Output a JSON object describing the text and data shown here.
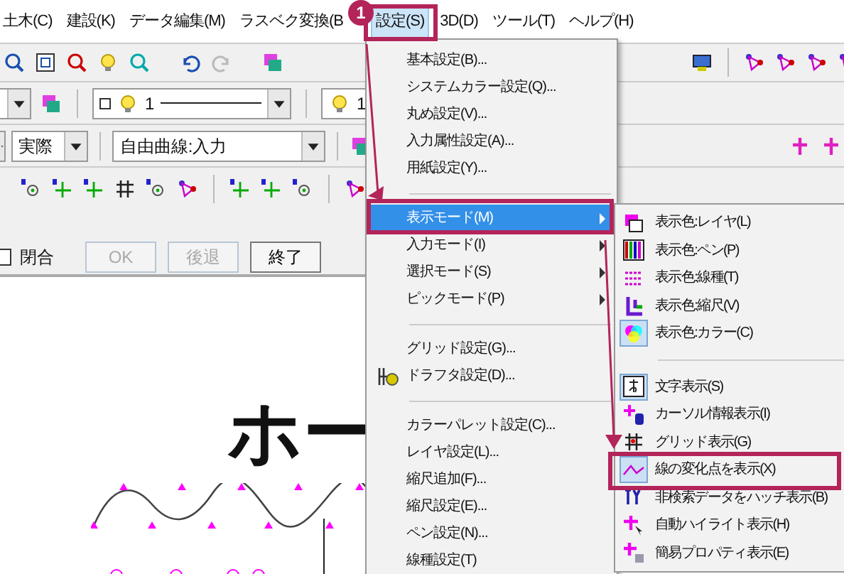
{
  "menubar": [
    {
      "label": "土木(C)",
      "selected": false
    },
    {
      "label": "建設(K)",
      "selected": false
    },
    {
      "label": "データ編集(M)",
      "selected": false
    },
    {
      "label": "ラスベク変換(B",
      "selected": false
    },
    {
      "label": "設定(S)",
      "selected": true
    },
    {
      "label": "3D(D)",
      "selected": false
    },
    {
      "label": "ツール(T)",
      "selected": false
    },
    {
      "label": "ヘルプ(H)",
      "selected": false
    }
  ],
  "toolbar": {
    "layer_combo": "1",
    "pen_combo": "1",
    "scale_combo": "実際",
    "command_combo": "自由曲線:入力"
  },
  "options": {
    "closed_label": "閉合",
    "closed_checked": false
  },
  "buttons": [
    {
      "label": "OK",
      "disabled": true
    },
    {
      "label": "後退",
      "disabled": true
    },
    {
      "label": "終了",
      "disabled": false
    }
  ],
  "canvas": {
    "text": "ホー"
  },
  "settings_menu": [
    {
      "kind": "item",
      "label": "基本設定(B)...",
      "selected": false,
      "submenu": false,
      "has_icon": false
    },
    {
      "kind": "item",
      "label": "システムカラー設定(Q)...",
      "selected": false,
      "submenu": false,
      "has_icon": false
    },
    {
      "kind": "item",
      "label": "丸め設定(V)...",
      "selected": false,
      "submenu": false,
      "has_icon": false
    },
    {
      "kind": "item",
      "label": "入力属性設定(A)...",
      "selected": false,
      "submenu": false,
      "has_icon": false
    },
    {
      "kind": "item",
      "label": "用紙設定(Y)...",
      "selected": false,
      "submenu": false,
      "has_icon": false
    },
    {
      "kind": "separator"
    },
    {
      "kind": "item",
      "label": "表示モード(M)",
      "selected": true,
      "submenu": true,
      "has_icon": false
    },
    {
      "kind": "item",
      "label": "入力モード(I)",
      "selected": false,
      "submenu": true,
      "has_icon": false
    },
    {
      "kind": "item",
      "label": "選択モード(S)",
      "selected": false,
      "submenu": true,
      "has_icon": false
    },
    {
      "kind": "item",
      "label": "ピックモード(P)",
      "selected": false,
      "submenu": true,
      "has_icon": false
    },
    {
      "kind": "separator"
    },
    {
      "kind": "item",
      "label": "グリッド設定(G)...",
      "selected": false,
      "submenu": false,
      "has_icon": false
    },
    {
      "kind": "item",
      "label": "ドラフタ設定(D)...",
      "selected": false,
      "submenu": false,
      "has_icon": true
    },
    {
      "kind": "separator"
    },
    {
      "kind": "item",
      "label": "カラーパレット設定(C)...",
      "selected": false,
      "submenu": false,
      "has_icon": false
    },
    {
      "kind": "item",
      "label": "レイヤ設定(L)...",
      "selected": false,
      "submenu": false,
      "has_icon": false
    },
    {
      "kind": "item",
      "label": "縮尺追加(F)...",
      "selected": false,
      "submenu": false,
      "has_icon": false
    },
    {
      "kind": "item",
      "label": "縮尺設定(E)...",
      "selected": false,
      "submenu": false,
      "has_icon": false
    },
    {
      "kind": "item",
      "label": "ペン設定(N)...",
      "selected": false,
      "submenu": false,
      "has_icon": false
    },
    {
      "kind": "item",
      "label": "線種設定(T)",
      "selected": false,
      "submenu": false,
      "has_icon": false
    }
  ],
  "display_submenu": [
    {
      "kind": "item",
      "label": "表示色:レイヤ(L)",
      "checked": false
    },
    {
      "kind": "item",
      "label": "表示色:ペン(P)",
      "checked": false
    },
    {
      "kind": "item",
      "label": "表示色:線種(T)",
      "checked": false
    },
    {
      "kind": "item",
      "label": "表示色:縮尺(V)",
      "checked": false
    },
    {
      "kind": "item",
      "label": "表示色:カラー(C)",
      "checked": true
    },
    {
      "kind": "separator"
    },
    {
      "kind": "item",
      "label": "文字表示(S)",
      "checked": true
    },
    {
      "kind": "item",
      "label": "カーソル情報表示(I)",
      "checked": false
    },
    {
      "kind": "item",
      "label": "グリッド表示(G)",
      "checked": false
    },
    {
      "kind": "item",
      "label": "線の変化点を表示(X)",
      "checked": true
    },
    {
      "kind": "item",
      "label": "非検索データをハッチ表示(B)",
      "checked": false
    },
    {
      "kind": "item",
      "label": "自動ハイライト表示(H)",
      "checked": false
    },
    {
      "kind": "item",
      "label": "簡易プロパティ表示(E)",
      "checked": false
    }
  ],
  "annotation": {
    "step": "1"
  }
}
